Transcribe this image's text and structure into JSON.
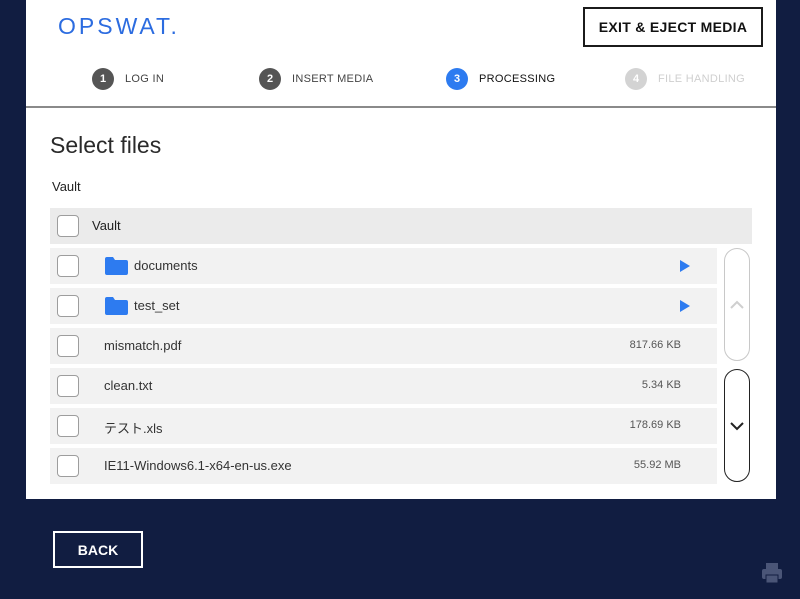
{
  "brand": {
    "logo_text": "OPSWAT."
  },
  "header": {
    "exit_label": "EXIT & EJECT MEDIA"
  },
  "steps": [
    {
      "num": "1",
      "label": "LOG IN",
      "state": "done"
    },
    {
      "num": "2",
      "label": "INSERT MEDIA",
      "state": "done"
    },
    {
      "num": "3",
      "label": "PROCESSING",
      "state": "active"
    },
    {
      "num": "4",
      "label": "FILE HANDLING",
      "state": "todo"
    }
  ],
  "main": {
    "title": "Select files",
    "breadcrumb": "Vault",
    "root_label": "Vault"
  },
  "files": [
    {
      "name": "documents",
      "type": "folder",
      "icon": "folder-icon"
    },
    {
      "name": "test_set",
      "type": "folder",
      "icon": "folder-icon"
    },
    {
      "name": "mismatch.pdf",
      "type": "file",
      "size": "817.66 KB"
    },
    {
      "name": "clean.txt",
      "type": "file",
      "size": "5.34 KB"
    },
    {
      "name": "テスト.xls",
      "type": "file",
      "size": "178.69 KB"
    },
    {
      "name": "IE11-Windows6.1-x64-en-us.exe",
      "type": "file",
      "size": "55.92 MB"
    }
  ],
  "footer": {
    "back_label": "BACK"
  },
  "colors": {
    "background": "#111d41",
    "accent": "#2d7bf0",
    "panel": "#ffffff"
  }
}
